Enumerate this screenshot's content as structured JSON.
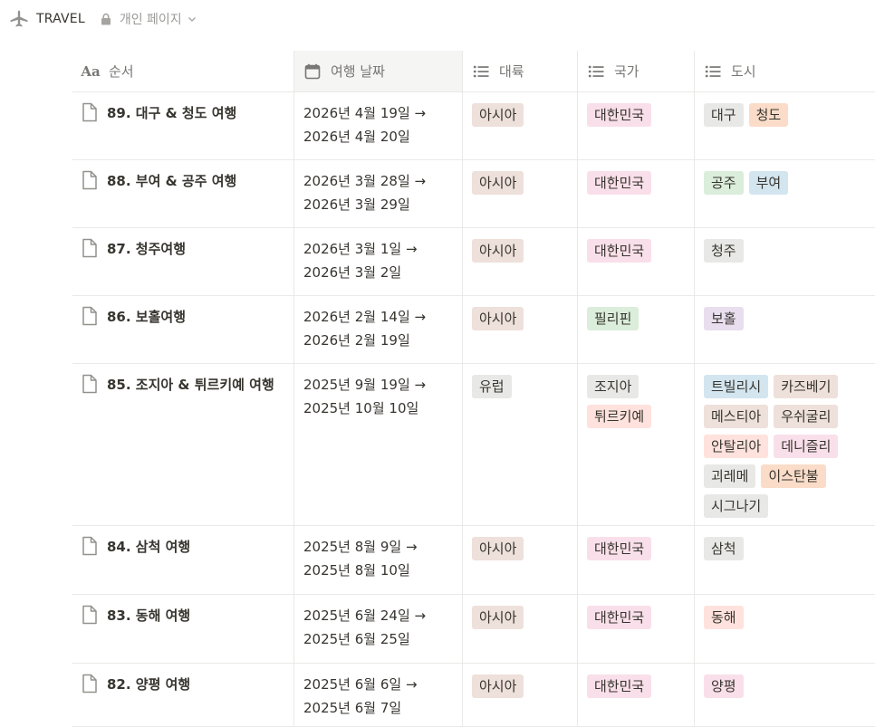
{
  "breadcrumb": {
    "title": "TRAVEL",
    "privacy": "개인 페이지"
  },
  "columns": [
    {
      "label": "순서",
      "icon": "text-property-icon"
    },
    {
      "label": "여행 날짜",
      "icon": "calendar-icon"
    },
    {
      "label": "대륙",
      "icon": "list-icon"
    },
    {
      "label": "국가",
      "icon": "list-icon"
    },
    {
      "label": "도시",
      "icon": "list-icon"
    }
  ],
  "colors": {
    "brown": "#eee0da",
    "pink": "#f9dfea",
    "gray": "#e8e8e6",
    "orange": "#fadcc8",
    "green": "#dbeddb",
    "blue": "#d3e5ef",
    "purple": "#e8deee",
    "red": "#ffe2dd",
    "yellow": "#fbf0d1"
  },
  "rows": [
    {
      "name": "89. 대구 & 청도 여행",
      "date": [
        "2026년 4월 19일 →",
        "2026년 4월 20일"
      ],
      "continent": [
        {
          "label": "아시아",
          "color": "brown"
        }
      ],
      "country": [
        {
          "label": "대한민국",
          "color": "pink"
        }
      ],
      "cities": [
        {
          "label": "대구",
          "color": "gray"
        },
        {
          "label": "청도",
          "color": "orange"
        }
      ]
    },
    {
      "name": "88. 부여 & 공주 여행",
      "date": [
        "2026년 3월 28일 →",
        "2026년 3월 29일"
      ],
      "continent": [
        {
          "label": "아시아",
          "color": "brown"
        }
      ],
      "country": [
        {
          "label": "대한민국",
          "color": "pink"
        }
      ],
      "cities": [
        {
          "label": "공주",
          "color": "green"
        },
        {
          "label": "부여",
          "color": "blue"
        }
      ]
    },
    {
      "name": "87. 청주여행",
      "date": [
        "2026년 3월 1일 →",
        "2026년 3월 2일"
      ],
      "continent": [
        {
          "label": "아시아",
          "color": "brown"
        }
      ],
      "country": [
        {
          "label": "대한민국",
          "color": "pink"
        }
      ],
      "cities": [
        {
          "label": "청주",
          "color": "gray"
        }
      ]
    },
    {
      "name": "86. 보홀여행",
      "date": [
        "2026년 2월 14일 →",
        "2026년 2월 19일"
      ],
      "continent": [
        {
          "label": "아시아",
          "color": "brown"
        }
      ],
      "country": [
        {
          "label": "필리핀",
          "color": "green"
        }
      ],
      "cities": [
        {
          "label": "보홀",
          "color": "purple"
        }
      ]
    },
    {
      "name": "85. 조지아 & 튀르키예 여행",
      "date": [
        "2025년 9월 19일 →",
        "2025년 10월 10일"
      ],
      "continent": [
        {
          "label": "유럽",
          "color": "gray"
        }
      ],
      "country": [
        {
          "label": "조지아",
          "color": "gray"
        },
        {
          "label": "튀르키예",
          "color": "red"
        }
      ],
      "cities": [
        {
          "label": "트빌리시",
          "color": "blue"
        },
        {
          "label": "카즈베기",
          "color": "brown"
        },
        {
          "label": "메스티아",
          "color": "brown"
        },
        {
          "label": "우쉬굴리",
          "color": "brown"
        },
        {
          "label": "안탈리아",
          "color": "red"
        },
        {
          "label": "데니즐리",
          "color": "pink"
        },
        {
          "label": "괴레메",
          "color": "gray"
        },
        {
          "label": "이스탄불",
          "color": "orange"
        },
        {
          "label": "시그나기",
          "color": "gray"
        }
      ]
    },
    {
      "name": "84. 삼척 여행",
      "date": [
        "2025년 8월 9일 →",
        "2025년 8월 10일"
      ],
      "continent": [
        {
          "label": "아시아",
          "color": "brown"
        }
      ],
      "country": [
        {
          "label": "대한민국",
          "color": "pink"
        }
      ],
      "cities": [
        {
          "label": "삼척",
          "color": "gray"
        }
      ]
    },
    {
      "name": "83. 동해 여행",
      "date": [
        "2025년 6월 24일 →",
        "2025년 6월 25일"
      ],
      "continent": [
        {
          "label": "아시아",
          "color": "brown"
        }
      ],
      "country": [
        {
          "label": "대한민국",
          "color": "pink"
        }
      ],
      "cities": [
        {
          "label": "동해",
          "color": "red"
        }
      ]
    },
    {
      "name": "82. 양평 여행",
      "date": [
        "2025년 6월 6일 →",
        "2025년 6월 7일"
      ],
      "continent": [
        {
          "label": "아시아",
          "color": "brown"
        }
      ],
      "country": [
        {
          "label": "대한민국",
          "color": "pink"
        }
      ],
      "cities": [
        {
          "label": "양평",
          "color": "pink"
        }
      ]
    }
  ]
}
